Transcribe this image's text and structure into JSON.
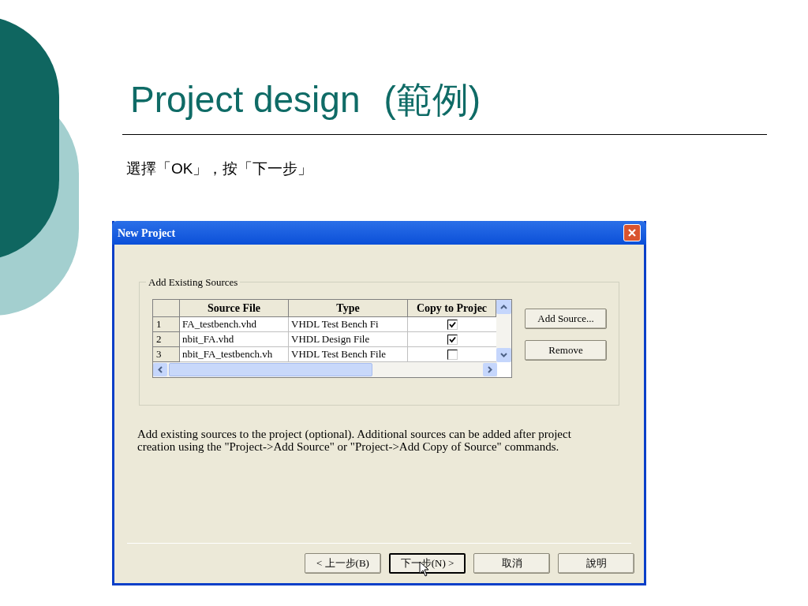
{
  "slide": {
    "title": "Project design",
    "title_note": "(範例)",
    "subtitle": "選擇「OK」，按「下一步」"
  },
  "dialog": {
    "title": "New Project",
    "group_label": "Add Existing Sources",
    "columns": [
      "Source File",
      "Type",
      "Copy to Projec"
    ],
    "rows": [
      {
        "index": "1",
        "file": "FA_testbench.vhd",
        "type": "VHDL Test Bench Fi",
        "checked": true
      },
      {
        "index": "2",
        "file": "nbit_FA.vhd",
        "type": "VHDL Design File",
        "checked": true
      },
      {
        "index": "3",
        "file": "nbit_FA_testbench.vh",
        "type": "VHDL Test Bench File",
        "checked": false
      }
    ],
    "side_buttons": [
      "Add Source...",
      "Remove"
    ],
    "description": "Add existing sources to the project (optional). Additional sources can be added after project creation using the \"Project->Add Source\" or \"Project->Add Copy of Source\" commands.",
    "footer_buttons": [
      {
        "label": "< 上一步(B)",
        "selected": false
      },
      {
        "label": "下一步(N) >",
        "selected": true
      },
      {
        "label": "取消",
        "selected": false
      },
      {
        "label": "說明",
        "selected": false
      }
    ]
  }
}
